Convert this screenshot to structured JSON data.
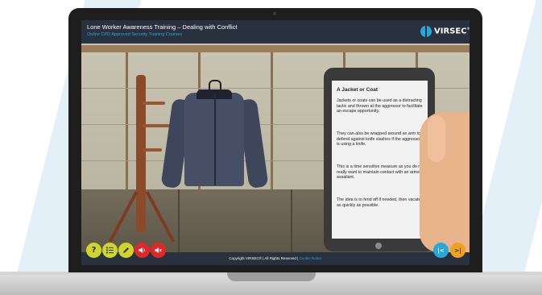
{
  "header": {
    "title": "Lone Worker Awareness Training – Dealing with Conflict",
    "subtitle": "Online CPD Approved Security Training Courses"
  },
  "logo": {
    "text": "VIRSEC",
    "mark": "®"
  },
  "card": {
    "heading": "A Jacket or Coat",
    "paragraphs": [
      "Jackets or coats can be used as a distracting tactic and thrown at the aggressor to facilitate an escape opportunity.",
      "They can also be wrapped around an arm to defend against knife slashes if the aggressor is using a knife.",
      "This is a time sensitive measure as you do not really want to maintain contact with an armed assailant.",
      "The idea is to fend off if needed, then vacate as quickly as possible."
    ]
  },
  "footer": {
    "copyright": "Copyright VIRSEC® | All Rights Reserved |",
    "cookie_link": "Cookie Notice"
  },
  "controls": {
    "help_label": "?",
    "back_label": "|<",
    "next_label": ">|"
  },
  "colors": {
    "bar": "#28313d",
    "accent": "#27a8dc",
    "yellow": "#cfd52a",
    "red": "#e0282a",
    "orange": "#f0a020"
  },
  "icons": [
    "help-icon",
    "menu-list-icon",
    "pencil-icon",
    "sound-icon",
    "mute-icon",
    "skip-back-icon",
    "skip-forward-icon"
  ]
}
